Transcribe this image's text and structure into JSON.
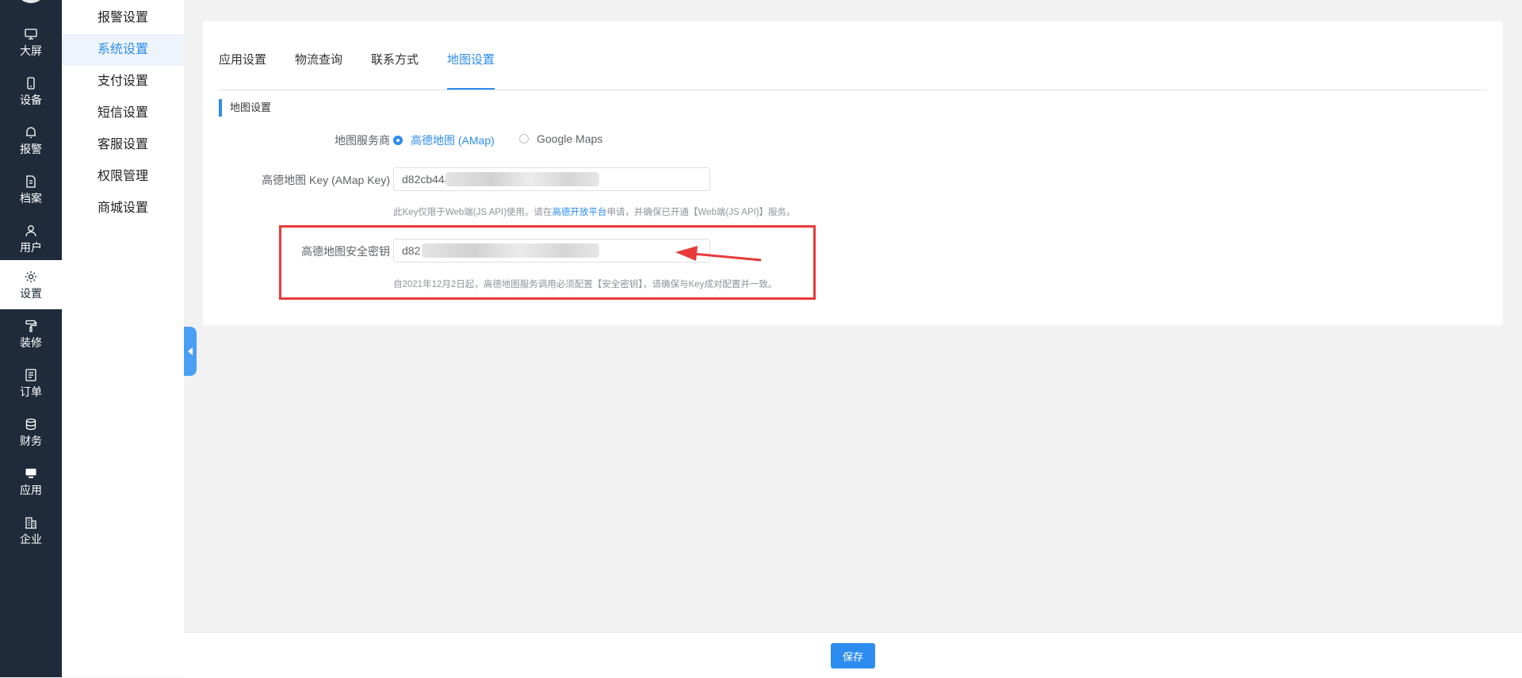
{
  "rail": {
    "items": [
      {
        "label": "大屏",
        "icon": "monitor-icon"
      },
      {
        "label": "设备",
        "icon": "phone-icon"
      },
      {
        "label": "报警",
        "icon": "bell-icon"
      },
      {
        "label": "档案",
        "icon": "document-icon"
      },
      {
        "label": "用户",
        "icon": "user-icon"
      },
      {
        "label": "设置",
        "icon": "gear-icon"
      },
      {
        "label": "装修",
        "icon": "paint-roller-icon"
      },
      {
        "label": "订单",
        "icon": "list-icon"
      },
      {
        "label": "财务",
        "icon": "database-icon"
      },
      {
        "label": "应用",
        "icon": "app-monitor-icon"
      },
      {
        "label": "企业",
        "icon": "building-icon"
      }
    ],
    "active_index": 5
  },
  "submenu": {
    "items": [
      "报警设置",
      "系统设置",
      "支付设置",
      "短信设置",
      "客服设置",
      "权限管理",
      "商城设置"
    ],
    "active_index": 1
  },
  "tabs": {
    "items": [
      "应用设置",
      "物流查询",
      "联系方式",
      "地图设置"
    ],
    "active_index": 3
  },
  "section": {
    "title": "地图设置"
  },
  "form": {
    "provider": {
      "label": "地图服务商",
      "options": [
        "高德地图 (AMap)",
        "Google Maps"
      ],
      "selected": "高德地图 (AMap)"
    },
    "amap_key": {
      "label": "高德地图 Key (AMap Key)",
      "value": "d82cb44a",
      "hint_prefix": "此Key仅限于Web端(JS API)使用。请在",
      "hint_link": "高德开放平台",
      "hint_suffix": "申请，并确保已开通【Web端(JS API)】服务。"
    },
    "security_key": {
      "label": "高德地图安全密钥",
      "value": "d82",
      "hint": "自2021年12月2日起，高德地图服务调用必须配置【安全密钥】，请确保与Key成对配置并一致。"
    }
  },
  "footer": {
    "save_label": "保存"
  },
  "colors": {
    "accent": "#2d8cf0",
    "rail_bg": "#1f2b3a",
    "highlight": "#e83a3a"
  }
}
